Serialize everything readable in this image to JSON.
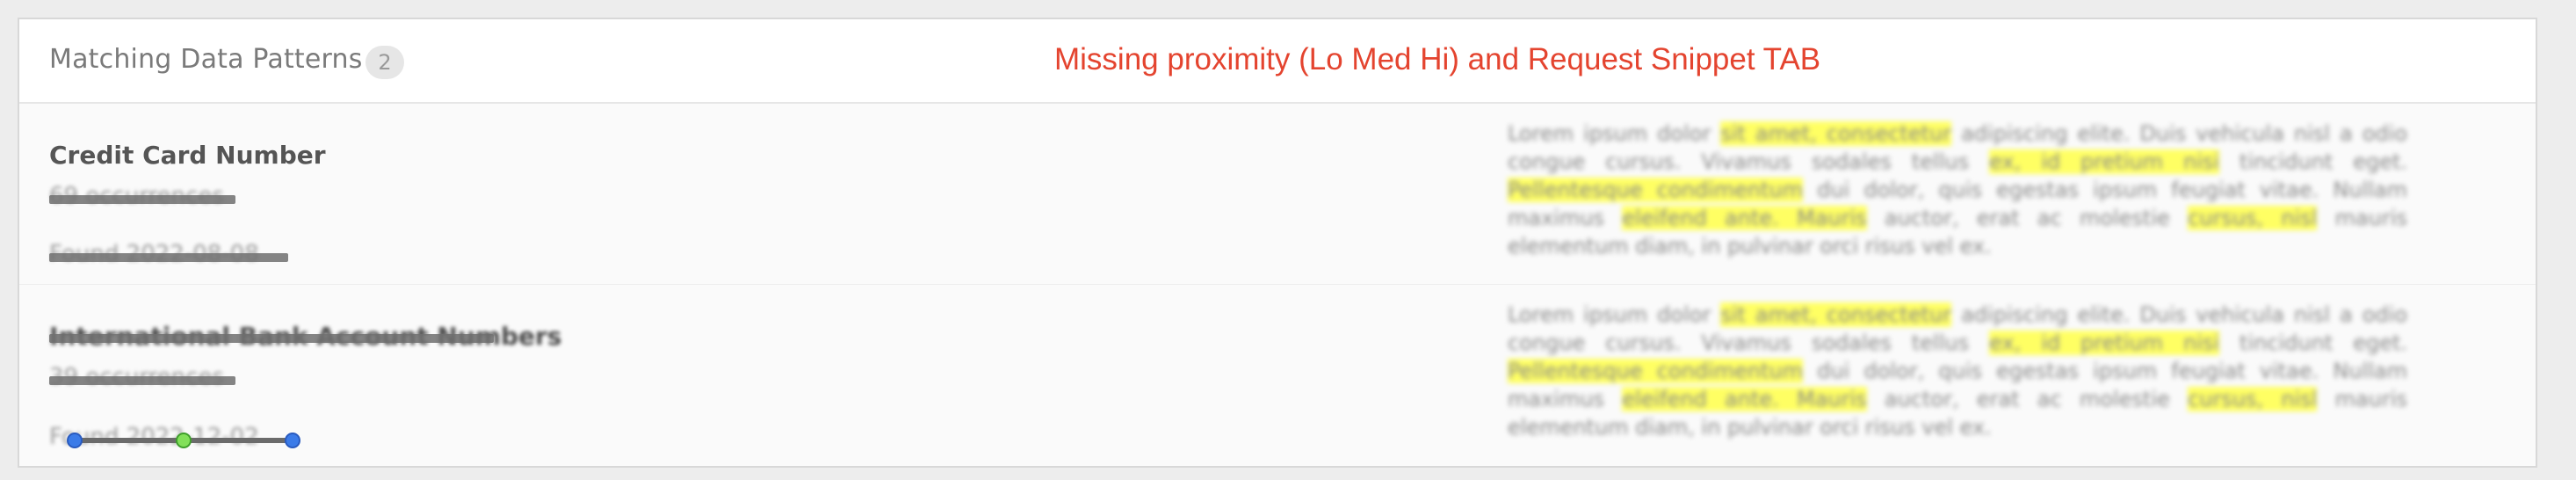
{
  "panel": {
    "title": "Matching Data Patterns",
    "count": "2"
  },
  "annotation": "Missing proximity (Lo Med Hi) and Request Snippet TAB",
  "rows": [
    {
      "name": "Credit Card Number",
      "occurrences": "69 occurrences",
      "found": "Found 2022-08-08",
      "snippet_parts": [
        [
          "Lorem ipsum dolor ",
          false
        ],
        [
          "sit amet, consectetur",
          true
        ],
        [
          " adipiscing elite. Duis vehicula nisl a odio congue cursus. Vivamus sodales tellus ",
          false
        ],
        [
          "ex, id pretium nisi",
          true
        ],
        [
          " tincidunt eget. ",
          false
        ],
        [
          "Pellentesque condimentum",
          true
        ],
        [
          " dui dolor, quis egestas ipsum feugiat vitae. Nullam maximus ",
          false
        ],
        [
          "eleifend ante. Mauris",
          true
        ],
        [
          " auctor, erat ac molestie ",
          false
        ],
        [
          "cursus, nisl",
          true
        ],
        [
          " mauris elementum diam, in pulvinar orci risus vel ex.",
          false
        ]
      ]
    },
    {
      "name": "International Bank Account Numbers",
      "occurrences": "39 occurrences",
      "found": "Found 2022-12-02",
      "snippet_parts": [
        [
          "Lorem ipsum dolor ",
          false
        ],
        [
          "sit amet, consectetur",
          true
        ],
        [
          " adipiscing elite. Duis vehicula nisl a odio congue cursus. Vivamus sodales tellus ",
          false
        ],
        [
          "ex, id pretium nisi",
          true
        ],
        [
          " tincidunt eget. ",
          false
        ],
        [
          "Pellentesque condimentum",
          true
        ],
        [
          " dui dolor, quis egestas ipsum feugiat vitae. Nullam maximus ",
          false
        ],
        [
          "eleifend ante. Mauris",
          true
        ],
        [
          " auctor, erat ac molestie ",
          false
        ],
        [
          "cursus, nisl",
          true
        ],
        [
          " mauris elementum diam, in pulvinar orci risus vel ex.",
          false
        ]
      ]
    }
  ],
  "colors": {
    "annotation": "#e4442f",
    "highlight": "#ffff63",
    "handle_blue": "#3b7be8",
    "handle_green": "#82e05a"
  }
}
